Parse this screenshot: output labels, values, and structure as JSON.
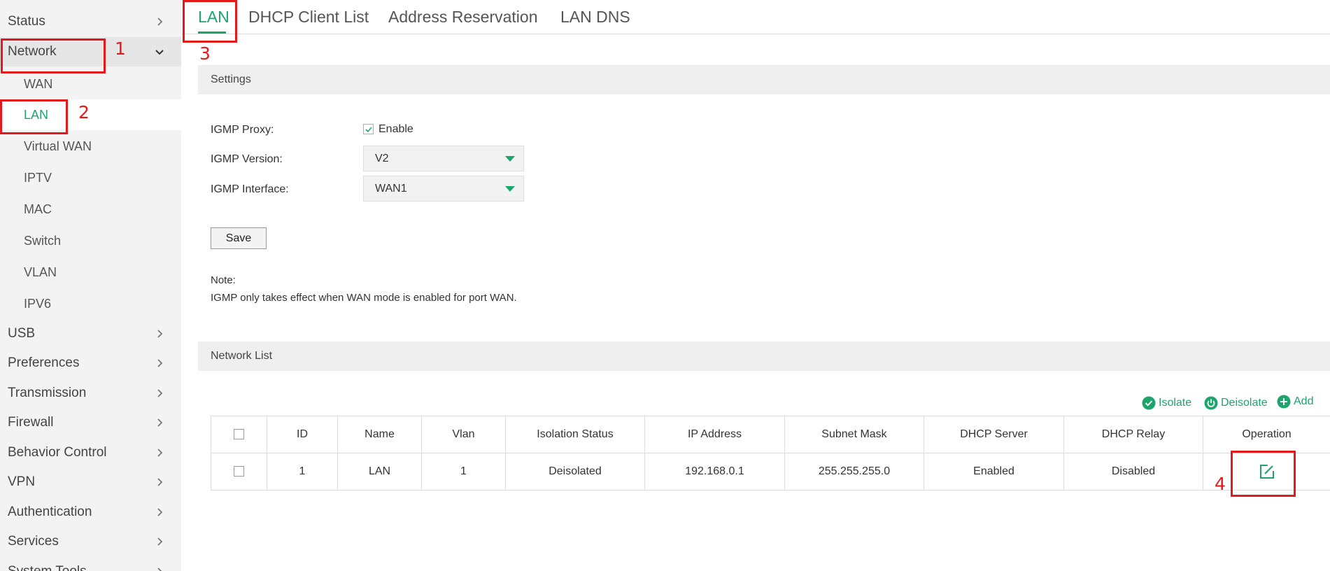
{
  "sidebar": {
    "items": [
      {
        "label": "Status"
      },
      {
        "label": "Network"
      },
      {
        "label": "USB"
      },
      {
        "label": "Preferences"
      },
      {
        "label": "Transmission"
      },
      {
        "label": "Firewall"
      },
      {
        "label": "Behavior Control"
      },
      {
        "label": "VPN"
      },
      {
        "label": "Authentication"
      },
      {
        "label": "Services"
      },
      {
        "label": "System Tools"
      }
    ],
    "network_subitems": [
      {
        "label": "WAN"
      },
      {
        "label": "LAN"
      },
      {
        "label": "Virtual WAN"
      },
      {
        "label": "IPTV"
      },
      {
        "label": "MAC"
      },
      {
        "label": "Switch"
      },
      {
        "label": "VLAN"
      },
      {
        "label": "IPV6"
      }
    ]
  },
  "tabs": [
    {
      "label": "LAN"
    },
    {
      "label": "DHCP Client List"
    },
    {
      "label": "Address Reservation"
    },
    {
      "label": "LAN DNS"
    }
  ],
  "settings": {
    "section_title": "Settings",
    "igmp_proxy_label": "IGMP Proxy:",
    "igmp_proxy_option": "Enable",
    "igmp_proxy_checked": true,
    "igmp_version_label": "IGMP Version:",
    "igmp_version_value": "V2",
    "igmp_interface_label": "IGMP Interface:",
    "igmp_interface_value": "WAN1",
    "save_label": "Save",
    "note_title": "Note:",
    "note_text": "IGMP only takes effect when WAN mode is enabled for port WAN."
  },
  "network_list": {
    "section_title": "Network List",
    "actions": {
      "isolate": "Isolate",
      "deisolate": "Deisolate",
      "add": "Add"
    },
    "columns": [
      "ID",
      "Name",
      "Vlan",
      "Isolation Status",
      "IP Address",
      "Subnet Mask",
      "DHCP Server",
      "DHCP Relay",
      "Operation"
    ],
    "rows": [
      {
        "id": "1",
        "name": "LAN",
        "vlan": "1",
        "isolation_status": "Deisolated",
        "ip": "192.168.0.1",
        "mask": "255.255.255.0",
        "dhcp_server": "Enabled",
        "dhcp_relay": "Disabled"
      }
    ]
  },
  "annotations": [
    "1",
    "2",
    "3",
    "4"
  ],
  "colors": {
    "accent": "#1da56b",
    "annotation": "#e3191c",
    "sidebar_bg": "#f3f3f3"
  }
}
